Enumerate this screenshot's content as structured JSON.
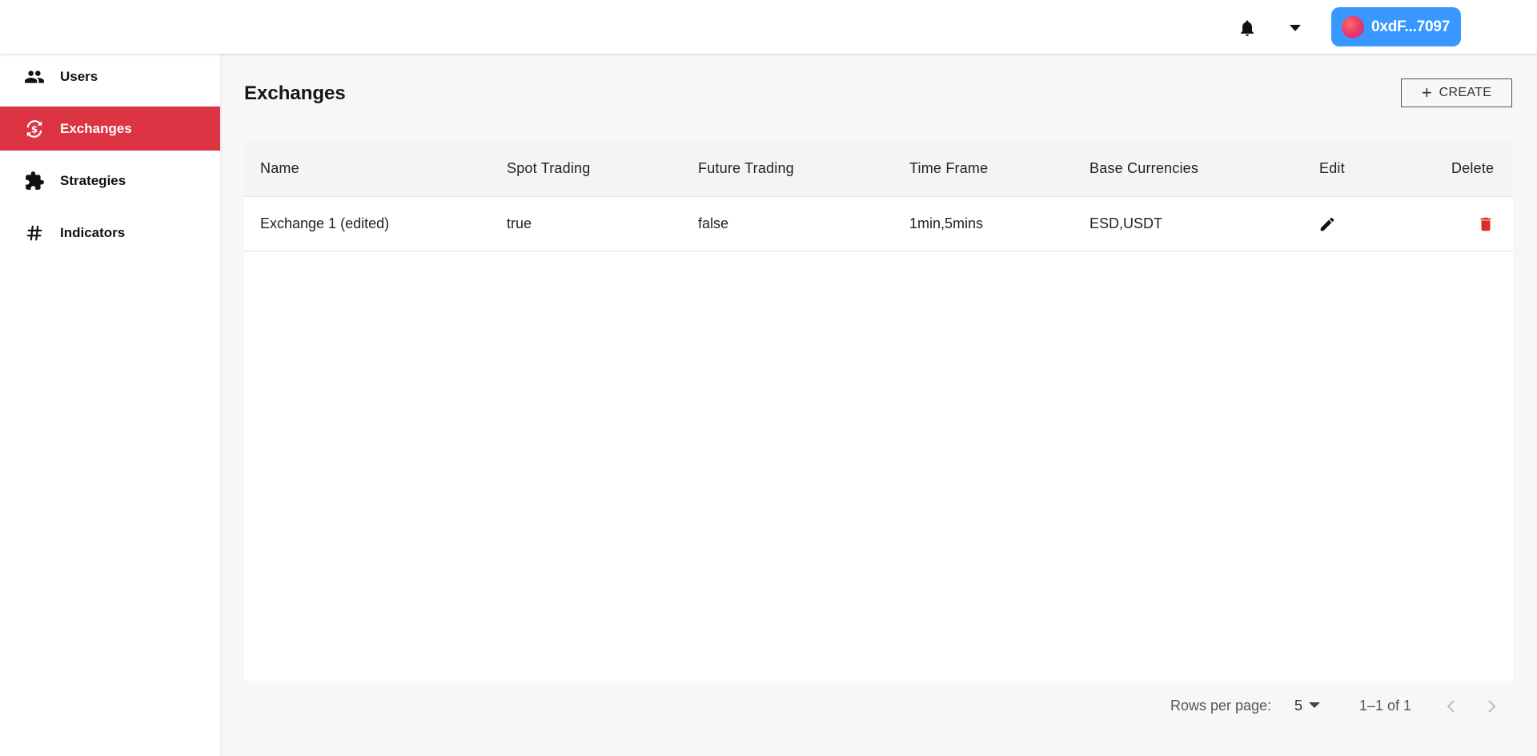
{
  "header": {
    "wallet_address": "0xdF...7097",
    "colors": {
      "wallet_button": "#3898ff"
    }
  },
  "sidebar": {
    "items": [
      {
        "label": "Users",
        "icon": "users-icon"
      },
      {
        "label": "Exchanges",
        "icon": "exchange-icon",
        "active": true
      },
      {
        "label": "Strategies",
        "icon": "puzzle-icon"
      },
      {
        "label": "Indicators",
        "icon": "hash-icon"
      }
    ],
    "active_color": "#dd3444"
  },
  "main": {
    "title": "Exchanges",
    "create_label": "CREATE"
  },
  "table": {
    "columns": [
      "Name",
      "Spot Trading",
      "Future Trading",
      "Time Frame",
      "Base Currencies",
      "Edit",
      "Delete"
    ],
    "rows": [
      {
        "name": "Exchange 1 (edited)",
        "spot": "true",
        "future": "false",
        "timeframe": "1min,5mins",
        "currencies": "ESD,USDT"
      }
    ]
  },
  "pagination": {
    "rows_per_page_label": "Rows per page:",
    "rows_per_page": "5",
    "range": "1–1 of 1"
  }
}
